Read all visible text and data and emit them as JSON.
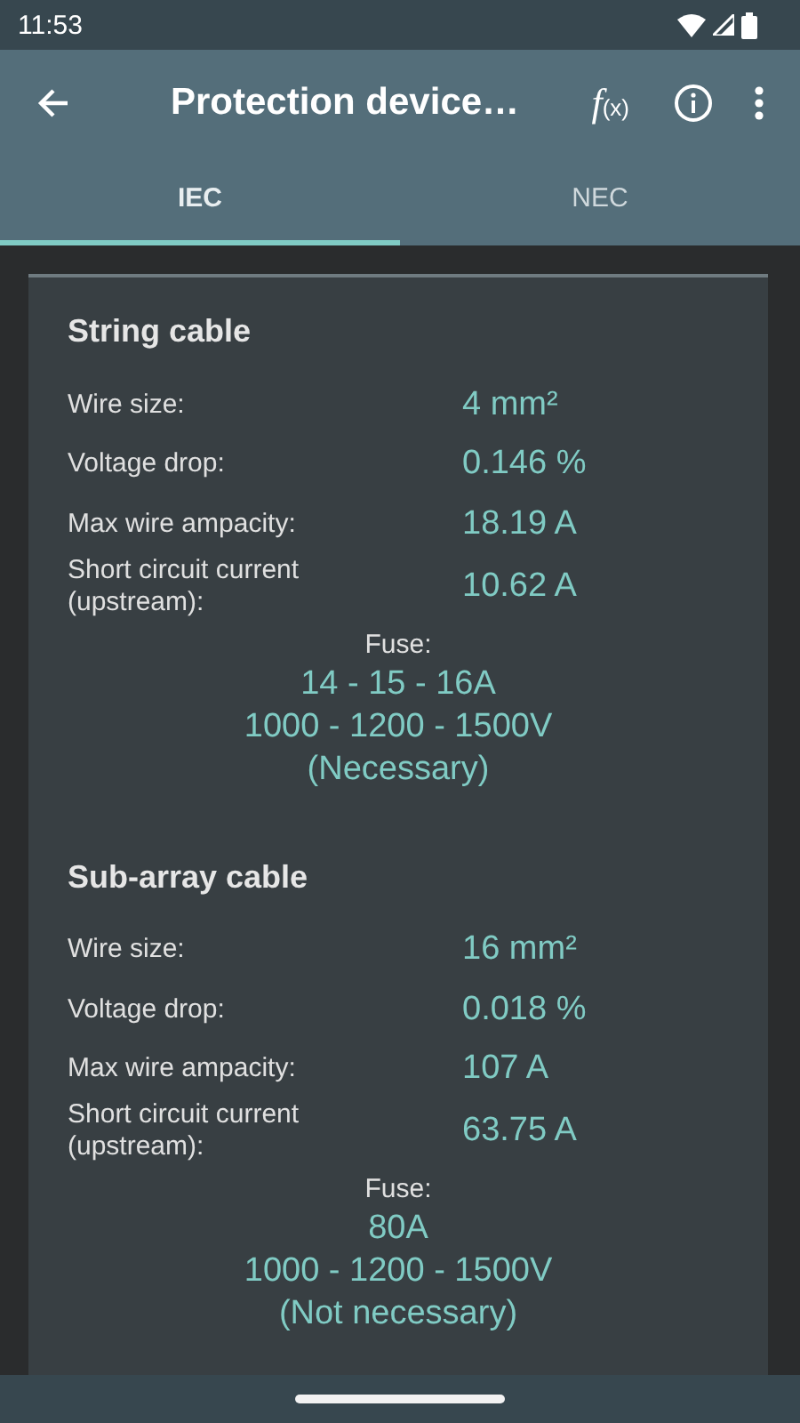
{
  "status_bar": {
    "time": "11:53"
  },
  "toolbar": {
    "title": "Protection device…",
    "formula_button": "f",
    "formula_sub": "(x)"
  },
  "tabs": [
    {
      "label": "IEC",
      "selected": true
    },
    {
      "label": "NEC",
      "selected": false
    }
  ],
  "sections": [
    {
      "title": "String cable",
      "rows": [
        {
          "label": "Wire size:",
          "value": "4 mm²"
        },
        {
          "label": "Voltage drop:",
          "value": "0.146 %"
        },
        {
          "label": "Max wire ampacity:",
          "value": "18.19 A"
        },
        {
          "label": "Short circuit current (upstream):",
          "value": "10.62 A"
        }
      ],
      "fuse_label": "Fuse:",
      "fuse_lines": [
        "14 - 15 - 16A",
        "1000 - 1200 - 1500V",
        "(Necessary)"
      ]
    },
    {
      "title": "Sub-array cable",
      "rows": [
        {
          "label": "Wire size:",
          "value": "16 mm²"
        },
        {
          "label": "Voltage drop:",
          "value": "0.018 %"
        },
        {
          "label": "Max wire ampacity:",
          "value": "107 A"
        },
        {
          "label": "Short circuit current (upstream):",
          "value": "63.75 A"
        }
      ],
      "fuse_label": "Fuse:",
      "fuse_lines": [
        "80A",
        "1000 - 1200 - 1500V",
        "(Not necessary)"
      ]
    }
  ]
}
